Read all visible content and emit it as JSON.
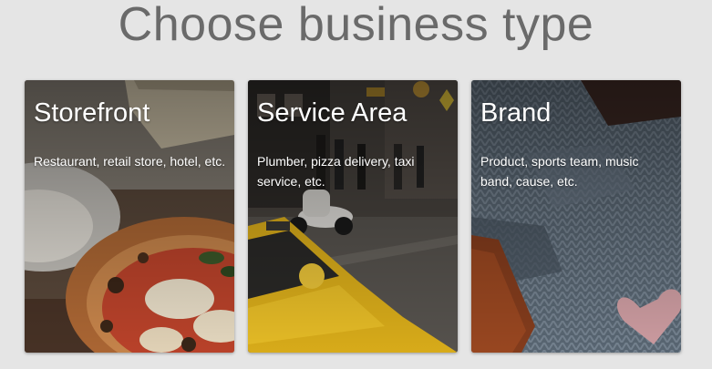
{
  "header": {
    "title": "Choose business type"
  },
  "cards": [
    {
      "title": "Storefront",
      "description": "Restaurant, retail store, hotel, etc.",
      "image": "pizza-photo"
    },
    {
      "title": "Service Area",
      "description": "Plumber, pizza delivery, taxi service, etc.",
      "image": "street-taxi-photo"
    },
    {
      "title": "Brand",
      "description": "Product, sports team, music band, cause, etc.",
      "image": "knit-sweater-photo"
    }
  ],
  "colors": {
    "background": "#e5e5e5",
    "title_text": "#6a6a6a",
    "card_text": "#ffffff"
  }
}
